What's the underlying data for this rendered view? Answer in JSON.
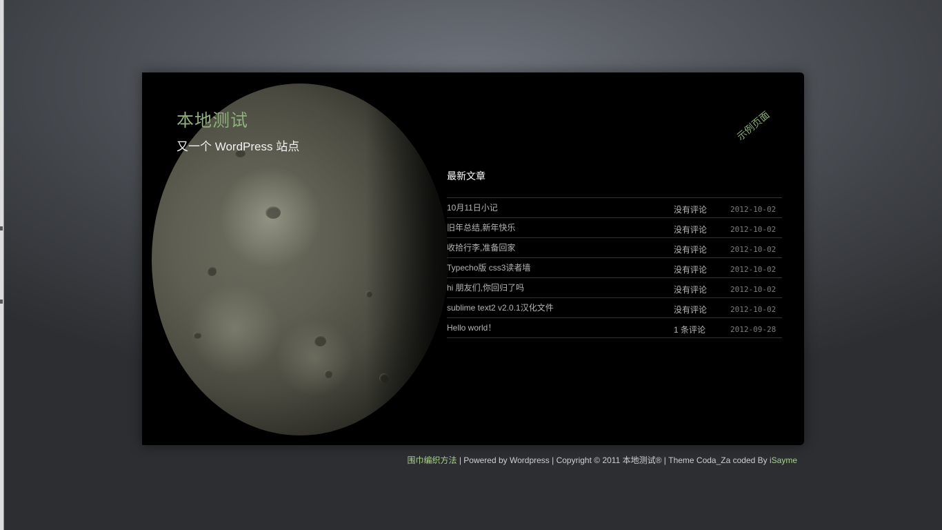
{
  "header": {
    "title": "本地测试",
    "description": "又一个 WordPress 站点",
    "nav_link": "示例页面"
  },
  "recent_posts": {
    "heading": "最新文章",
    "items": [
      {
        "title": "10月11日小记",
        "comments": "没有评论",
        "date": "2012-10-02"
      },
      {
        "title": "旧年总结,新年快乐",
        "comments": "没有评论",
        "date": "2012-10-02"
      },
      {
        "title": "收拾行李,准备回家",
        "comments": "没有评论",
        "date": "2012-10-02"
      },
      {
        "title": "Typecho版 css3读者墙",
        "comments": "没有评论",
        "date": "2012-10-02"
      },
      {
        "title": "hi 朋友们,你回归了吗",
        "comments": "没有评论",
        "date": "2012-10-02"
      },
      {
        "title": "sublime text2 v2.0.1汉化文件",
        "comments": "没有评论",
        "date": "2012-10-02"
      },
      {
        "title": "Hello world！",
        "comments": "1 条评论",
        "date": "2012-09-28"
      }
    ]
  },
  "footer": {
    "link1": "围巾编织方法",
    "sep1": " | ",
    "powered": "Powered by Wordpress",
    "sep2": " | ",
    "copyright": "Copyright © 2011 本地测试®",
    "sep3": " | ",
    "theme": "Theme Coda_Za coded By ",
    "author_link": "iSayme"
  },
  "colors": {
    "accent": "#8fb07a",
    "footer_link": "#a9d08f",
    "panel_bg": "#000000"
  },
  "decorations": {
    "moon_image": "moon photograph (gibbous phase)"
  }
}
